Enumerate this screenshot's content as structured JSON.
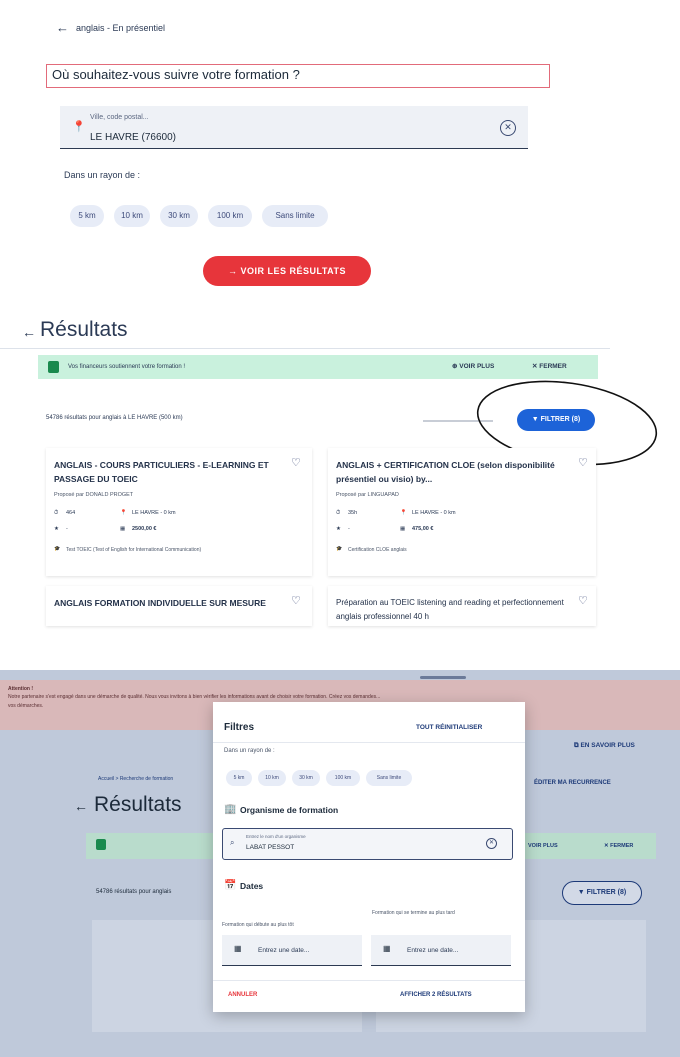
{
  "panel1": {
    "breadcrumb": "anglais - En présentiel",
    "question": "Où souhaitez-vous suivre votre formation ?",
    "city_label": "Ville, code postal...",
    "city_value": "LE HAVRE (76600)",
    "radius_label": "Dans un rayon de :",
    "chips": [
      "5 km",
      "10 km",
      "30 km",
      "100 km",
      "Sans limite"
    ],
    "cta": "VOIR LES RÉSULTATS"
  },
  "panel2": {
    "title": "Résultats",
    "banner_text": "Vos financeurs soutiennent votre formation !",
    "banner_more": "VOIR PLUS",
    "banner_close": "FERMER",
    "count": "54786 résultats pour anglais à LE HAVRE (500 km)",
    "filter": "FILTRER (8)",
    "cards": [
      {
        "title": "ANGLAIS - COURS PARTICULIERS - E-LEARNING ET PASSAGE DU TOEIC",
        "provider": "Proposé par DONALD PROGET",
        "m1": "464",
        "m2": "LE HAVRE - 0 km",
        "m3": "-",
        "m4": "2500,00 €",
        "foot": "Test TOEIC (Test of English for International Communication)"
      },
      {
        "title": "ANGLAIS + CERTIFICATION CLOE (selon disponibilité présentiel ou visio) by...",
        "provider": "Proposé par LINGUAPAD",
        "m1": "35h",
        "m2": "LE HAVRE - 0 km",
        "m3": "-",
        "m4": "475,00 €",
        "foot": "Certification CLOE anglais"
      },
      {
        "title": "ANGLAIS FORMATION INDIVIDUELLE SUR MESURE"
      },
      {
        "title": "Préparation au TOEIC listening and reading et perfectionnement anglais professionnel 40 h"
      }
    ]
  },
  "panel3": {
    "alert_title": "Attention !",
    "alert_body": "Notre partenaire s'est engagé dans une démarche de qualité. Nous vous invitons à bien vérifier les informations avant de choisir votre formation. Créez vos demandes...",
    "alert_tail": "vos démarches.",
    "savoir_plus": "EN SAVOIR PLUS",
    "breadcrumb": "Accueil  >  Recherche de formation",
    "recurrence": "ÉDITER MA RECURRENCE",
    "title": "Résultats",
    "banner_more": "VOIR PLUS",
    "banner_close": "FERMER",
    "count": "54786 résultats pour anglais",
    "filter": "FILTRER (8)",
    "modal": {
      "title": "Filtres",
      "reset": "TOUT RÉINITIALISER",
      "radius_label": "Dans un rayon de :",
      "chips": [
        "5 km",
        "10 km",
        "30 km",
        "100 km",
        "Sans limite"
      ],
      "org_title": "Organisme de formation",
      "org_label": "Entrez le nom d'un organisme",
      "org_value": "LABAT PESSOT",
      "dates_title": "Dates",
      "start_label": "Formation qui débute au plus tôt",
      "end_label": "Formation qui se termine au plus tard",
      "date_placeholder": "Entrez une date...",
      "cancel": "ANNULER",
      "show": "AFFICHER 2 RÉSULTATS"
    }
  },
  "colors": {
    "accent_red": "#e7353b",
    "primary_blue": "#1d63d8",
    "banner_green": "#c9f1dd"
  }
}
